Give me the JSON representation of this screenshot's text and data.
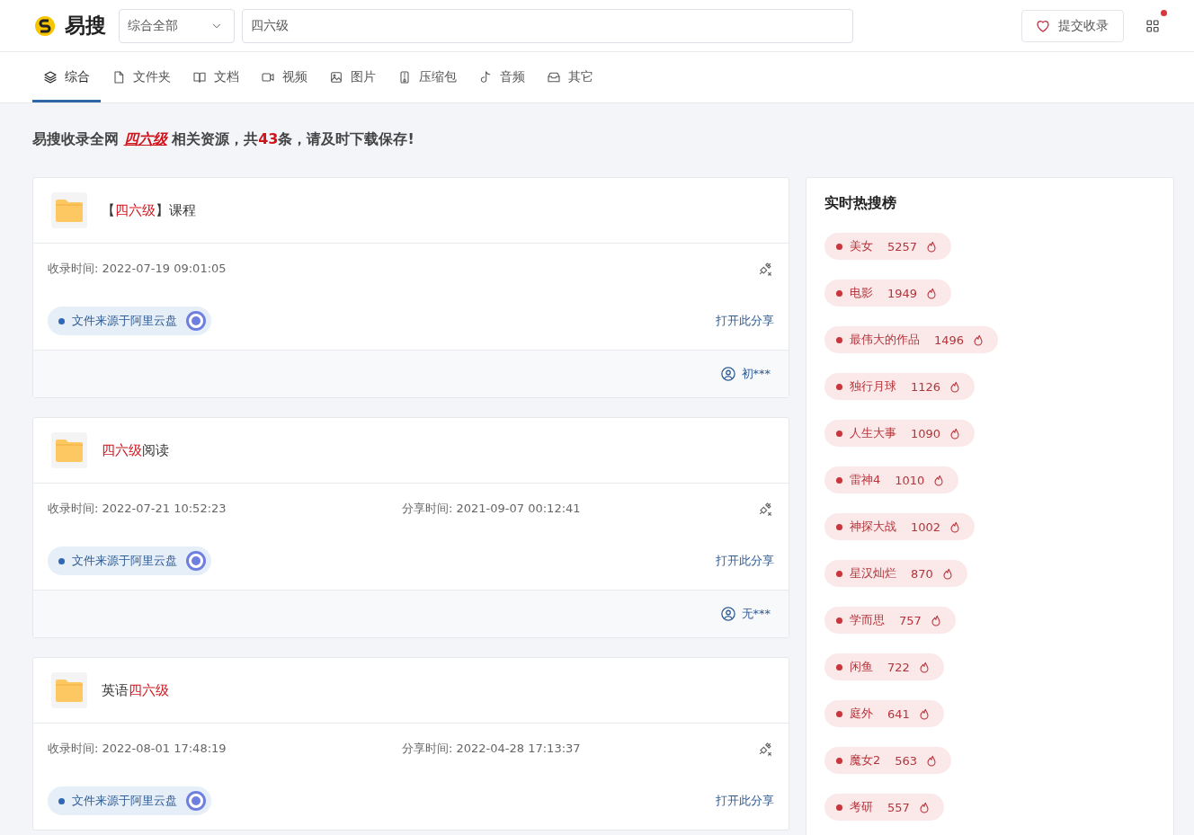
{
  "header": {
    "brand": "易搜",
    "category_select": "综合全部",
    "search_value": "四六级",
    "submit_button": "提交收录",
    "apps_has_badge": true
  },
  "tabs": [
    {
      "label": "综合",
      "selected": true
    },
    {
      "label": "文件夹",
      "selected": false
    },
    {
      "label": "文档",
      "selected": false
    },
    {
      "label": "视频",
      "selected": false
    },
    {
      "label": "图片",
      "selected": false
    },
    {
      "label": "压缩包",
      "selected": false
    },
    {
      "label": "音频",
      "selected": false
    },
    {
      "label": "其它",
      "selected": false
    }
  ],
  "summary": [
    {
      "text": "易搜收录全网 ",
      "kind": "plain"
    },
    {
      "text": "四六级",
      "kind": "keyword"
    },
    {
      "text": " 相关资源，共",
      "kind": "plain"
    },
    {
      "text": "43",
      "kind": "count"
    },
    {
      "text": "条，请及时下载保存!",
      "kind": "plain"
    }
  ],
  "results": [
    {
      "title": [
        {
          "text": "【",
          "highlight": false
        },
        {
          "text": "四六级",
          "highlight": true
        },
        {
          "text": "】课程",
          "highlight": false
        }
      ],
      "collected": "收录时间: 2022-07-19 09:01:05",
      "source": "文件来源于阿里云盘",
      "open_link": "打开此分享",
      "user": "初***"
    },
    {
      "title": [
        {
          "text": "四六级",
          "highlight": true
        },
        {
          "text": "阅读",
          "highlight": false
        }
      ],
      "collected": "收录时间: 2022-07-21 10:52:23",
      "shared": "分享时间: 2021-09-07 00:12:41",
      "source": "文件来源于阿里云盘",
      "open_link": "打开此分享",
      "user": "无***"
    },
    {
      "title": [
        {
          "text": "英语",
          "highlight": false
        },
        {
          "text": "四六级",
          "highlight": true
        }
      ],
      "collected": "收录时间: 2022-08-01 17:48:19",
      "shared": "分享时间: 2022-04-28 17:13:37",
      "source": "文件来源于阿里云盘",
      "open_link": "打开此分享"
    }
  ],
  "hot": {
    "title": "实时热搜榜",
    "items": [
      {
        "term": "美女",
        "count": "5257"
      },
      {
        "term": "电影",
        "count": "1949"
      },
      {
        "term": "最伟大的作品",
        "count": "1496"
      },
      {
        "term": "独行月球",
        "count": "1126"
      },
      {
        "term": "人生大事",
        "count": "1090"
      },
      {
        "term": "雷神4",
        "count": "1010"
      },
      {
        "term": "神探大战",
        "count": "1002"
      },
      {
        "term": "星汉灿烂",
        "count": "870"
      },
      {
        "term": "学而思",
        "count": "757"
      },
      {
        "term": "闲鱼",
        "count": "722"
      },
      {
        "term": "庭外",
        "count": "641"
      },
      {
        "term": "魔女2",
        "count": "563"
      },
      {
        "term": "考研",
        "count": "557"
      }
    ]
  }
}
